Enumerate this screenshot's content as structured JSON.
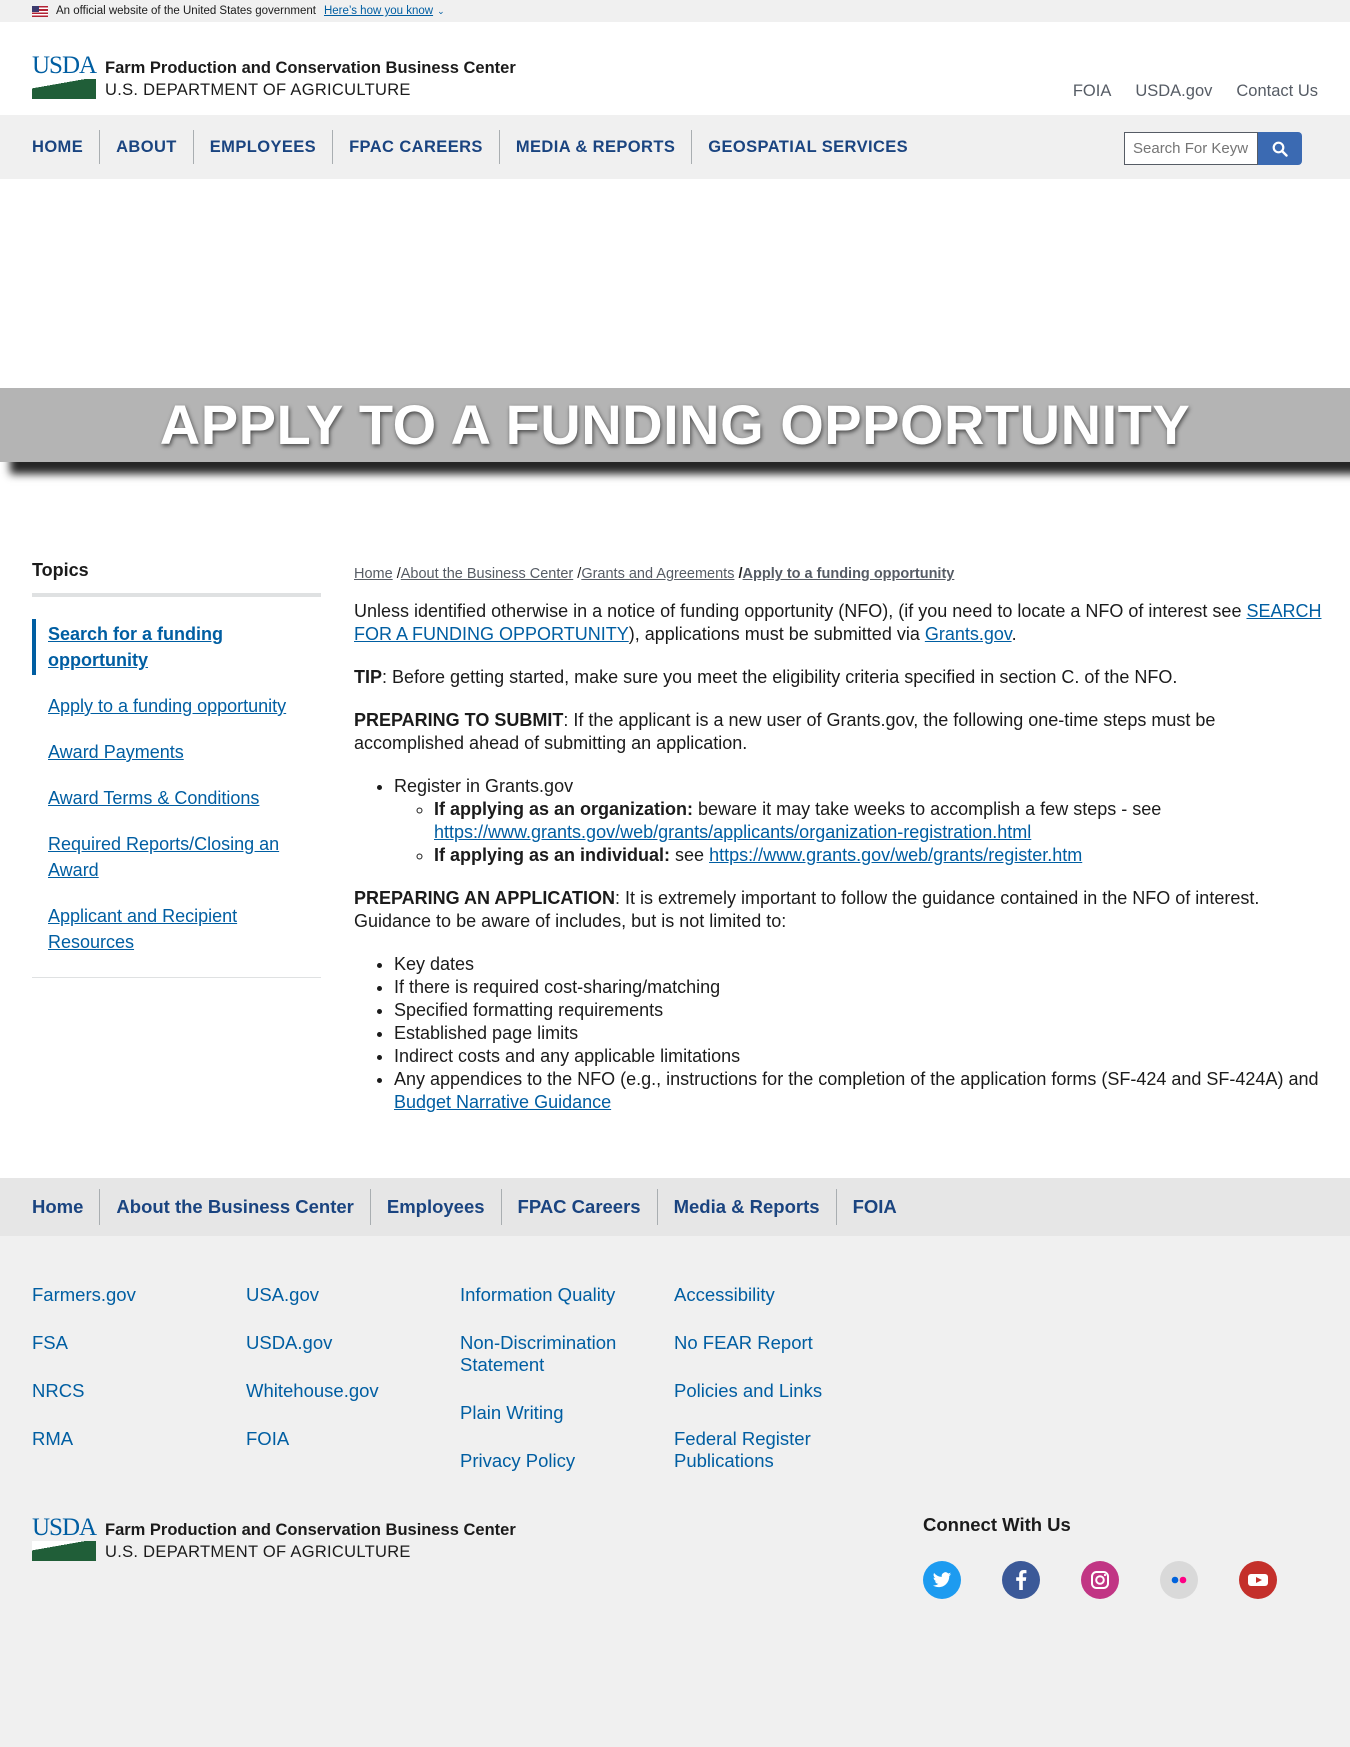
{
  "banner": {
    "text": "An official website of the United States government",
    "link": "Here’s how you know"
  },
  "header": {
    "logo_text": "USDA",
    "org_name": "Farm Production and Conservation Business Center",
    "dept": "U.S. DEPARTMENT OF AGRICULTURE",
    "utility_links": [
      "FOIA",
      "USDA.gov",
      "Contact Us"
    ]
  },
  "nav": {
    "items": [
      "HOME",
      "ABOUT",
      "EMPLOYEES",
      "FPAC CAREERS",
      "MEDIA & REPORTS",
      "GEOSPATIAL SERVICES"
    ],
    "search_placeholder": "Search For Keyw"
  },
  "hero": {
    "title": "APPLY TO A FUNDING OPPORTUNITY"
  },
  "sidebar": {
    "title": "Topics",
    "items": [
      "Search for a funding opportunity",
      "Apply to a funding opportunity",
      "Award Payments",
      "Award Terms & Conditions",
      "Required Reports/Closing an Award",
      "Applicant and Recipient Resources"
    ]
  },
  "breadcrumb": {
    "items": [
      "Home",
      "About the Business Center",
      "Grants and Agreements"
    ],
    "current": "Apply to a funding opportunity",
    "separator": " /"
  },
  "content": {
    "intro_1": "Unless identified otherwise in a notice of funding opportunity (NFO), (if you need to locate a NFO of interest see ",
    "intro_link": "SEARCH FOR A FUNDING OPPORTUNITY",
    "intro_2": "), applications must be submitted via ",
    "intro_link_2": "Grants.gov",
    "intro_3": ".",
    "tip_label": "TIP",
    "tip_text": ": Before getting started, make sure you meet the eligibility criteria specified in section C. of the NFO.",
    "prep_submit_label": "PREPARING TO SUBMIT",
    "prep_submit_text": ": If the applicant is a new user of Grants.gov, the following one-time steps must be accomplished ahead of submitting an application.",
    "register": "Register in Grants.gov",
    "org_label": "If applying as an organization:",
    "org_text": " beware it may take weeks to accomplish a few steps - see ",
    "org_link": "https://www.grants.gov/web/grants/applicants/organization-registration.html",
    "ind_label": "If applying as an individual:",
    "ind_text": " see ",
    "ind_link": "https://www.grants.gov/web/grants/register.htm",
    "prep_app_label": "PREPARING AN APPLICATION",
    "prep_app_text": ": It is extremely important to follow the guidance contained in the NFO of interest. Guidance to be aware of includes, but is not limited to:",
    "guidance": [
      "Key dates",
      "If there is required cost-sharing/matching",
      "Specified formatting requirements",
      "Established page limits",
      "Indirect costs and any applicable limitations"
    ],
    "appendix_text": "Any appendices to the NFO (e.g., instructions for the completion of the application forms (SF-424  and SF-424A) and ",
    "appendix_link": "Budget Narrative Guidance"
  },
  "footer": {
    "nav": [
      "Home",
      "About the Business Center",
      "Employees",
      "FPAC Careers",
      "Media & Reports",
      "FOIA"
    ],
    "col1": [
      "Farmers.gov",
      "FSA",
      "NRCS",
      "RMA"
    ],
    "col2": [
      "USA.gov",
      "USDA.gov",
      "Whitehouse.gov",
      "FOIA"
    ],
    "col3": [
      "Information Quality",
      "Non-Discrimination Statement",
      "Plain Writing",
      "Privacy Policy"
    ],
    "col4": [
      "Accessibility",
      "No FEAR Report",
      "Policies and Links",
      "Federal Register Publications"
    ],
    "connect_title": "Connect With Us",
    "social": [
      {
        "name": "twitter-icon",
        "color": "#1d9bf0",
        "glyph": "t"
      },
      {
        "name": "facebook-icon",
        "color": "#3b5998",
        "glyph": "f"
      },
      {
        "name": "instagram-icon",
        "color": "#c13584",
        "glyph": "◎"
      },
      {
        "name": "flickr-icon",
        "color": "#d9d9d9",
        "glyph": "••"
      },
      {
        "name": "youtube-icon",
        "color": "#c4302b",
        "glyph": "▶"
      }
    ]
  },
  "colors": {
    "brand_blue": "#005ea2",
    "nav_text": "#1a4480",
    "usda_green": "#205e38",
    "search_button": "#3b6ab2"
  }
}
